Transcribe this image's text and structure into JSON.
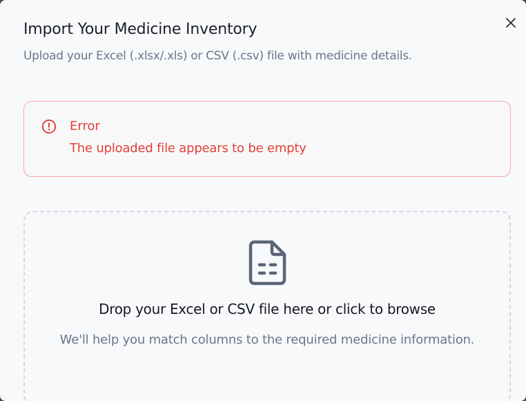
{
  "dialog": {
    "title": "Import Your Medicine Inventory",
    "subtitle": "Upload your Excel (.xlsx/.xls) or CSV (.csv) file with medicine details.",
    "close_icon": "close-icon"
  },
  "error": {
    "icon": "alert-circle-icon",
    "title": "Error",
    "message": "The uploaded file appears to be empty"
  },
  "dropzone": {
    "icon": "file-spreadsheet-icon",
    "title": "Drop your Excel or CSV file here or click to browse",
    "hint": "We'll help you match columns to the required medicine information."
  },
  "colors": {
    "error": "#e23f35",
    "error_border": "#f0a9a3",
    "text_primary": "#1b1f27",
    "text_muted": "#6b7589",
    "icon": "#5b6478",
    "background": "#f8f9fb"
  }
}
